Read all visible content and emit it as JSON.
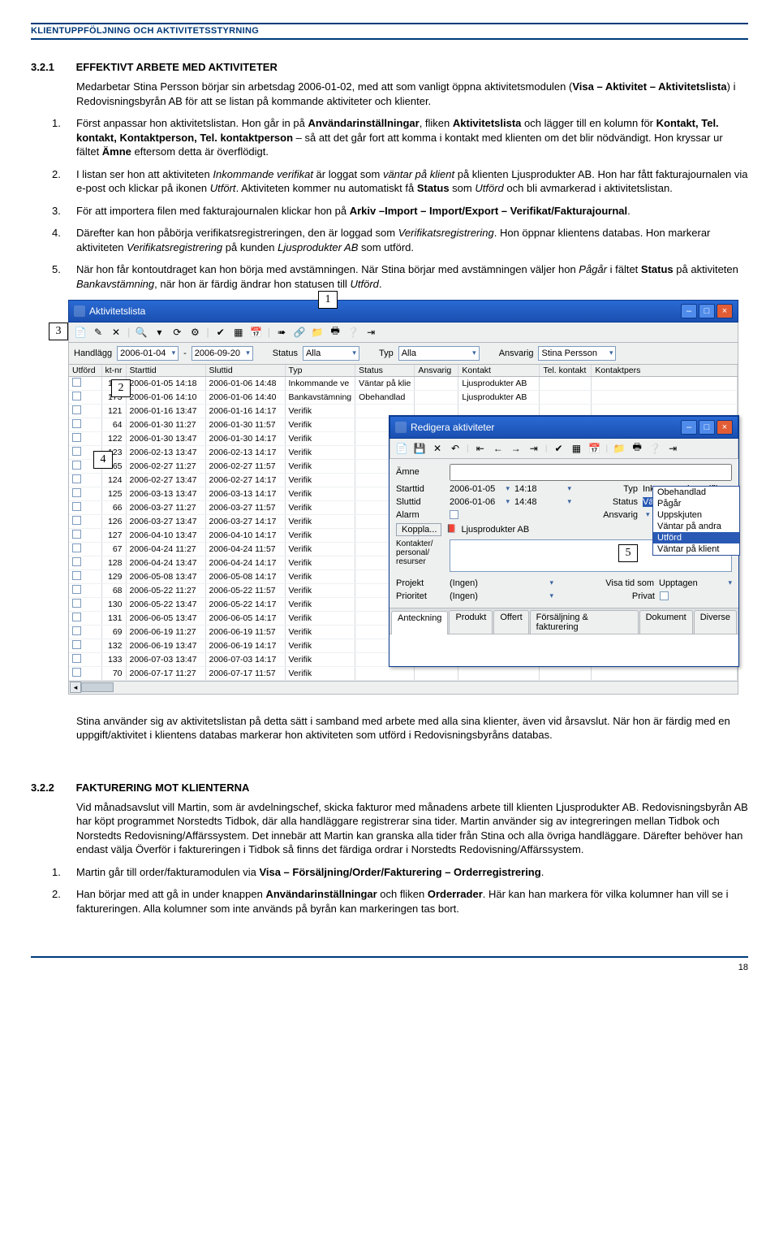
{
  "page": {
    "header": "KLIENTUPPFÖLJNING OCH AKTIVITETSSTYRNING",
    "pagenum": "18"
  },
  "sec1": {
    "num": "3.2.1",
    "title": "EFFEKTIVT ARBETE MED AKTIVITETER",
    "intro_a": "Medarbetar Stina Persson börjar sin arbetsdag 2006-01-02, med att som vanligt öppna aktivitetsmodulen (",
    "intro_b": "Visa – Aktivitet – Aktivitetslista",
    "intro_c": ") i Redovisningsbyrån AB för att se listan på kommande aktiviteter och klienter.",
    "li1_a": "Först anpassar hon aktivitetslistan. Hon går in på ",
    "li1_b": "Användarinställningar",
    "li1_c": ", fliken ",
    "li1_d": "Aktivitetslista",
    "li1_e": " och lägger till en kolumn för ",
    "li1_f": "Kontakt, Tel. kontakt, Kontaktperson, Tel. kontaktperson",
    "li1_g": " – så att det går fort att komma i kontakt med klienten om det blir nödvändigt. Hon kryssar ur fältet ",
    "li1_h": "Ämne",
    "li1_i": " eftersom detta är överflödigt.",
    "li2_a": "I listan ser hon att aktiviteten ",
    "li2_b": "Inkommande verifikat",
    "li2_c": " är loggat som ",
    "li2_d": "väntar på klient",
    "li2_e": " på klienten Ljusprodukter AB. Hon har fått fakturajournalen via e-post och klickar på ikonen ",
    "li2_f": "Utfört",
    "li2_g": ". Aktiviteten kommer nu automatiskt få ",
    "li2_h": "Status",
    "li2_i": " som ",
    "li2_j": "Utförd",
    "li2_k": " och bli avmarkerad i aktivitetslistan.",
    "li3_a": "För att importera filen med fakturajournalen klickar hon på ",
    "li3_b": "Arkiv –Import – Import/Export – Verifikat/Fakturajournal",
    "li3_c": ".",
    "li4_a": "Därefter kan hon påbörja verifikatsregistreringen, den är loggad som ",
    "li4_b": "Verifikatsregistrering",
    "li4_c": ". Hon öppnar klientens databas. Hon markerar aktiviteten ",
    "li4_d": "Verifikatsregistrering",
    "li4_e": " på kunden ",
    "li4_f": "Ljusprodukter AB",
    "li4_g": " som utförd.",
    "li5_a": "När hon får kontoutdraget kan hon börja med avstämningen. När Stina börjar med avstämningen väljer hon ",
    "li5_b": "Pågår",
    "li5_c": " i fältet ",
    "li5_d": "Status",
    "li5_e": " på aktiviteten ",
    "li5_f": "Bankavstämning",
    "li5_g": ", när hon är färdig ändrar hon statusen till ",
    "li5_h": "Utförd",
    "li5_i": ".",
    "footer_para": "Stina använder sig av aktivitetslistan på detta sätt i samband med arbete med alla sina klienter, även vid årsavslut. När hon är färdig med en uppgift/aktivitet i klientens databas markerar hon aktiviteten som utförd i Redovisningsbyråns databas."
  },
  "shot1": {
    "title": "Aktivitetslista",
    "filters": {
      "handlagg_label": "Handlägg",
      "date1": "2006-01-04",
      "date2": "2006-09-20",
      "status_lbl": "Status",
      "status_val": "Alla",
      "typ_lbl": "Typ",
      "typ_val": "Alla",
      "ansvarig_lbl": "Ansvarig",
      "ansvarig_val": "Stina Persson"
    },
    "cols": {
      "utford": "Utförd",
      "ktnr": "kt-nr",
      "starttid": "Starttid",
      "sluttid": "Sluttid",
      "typ": "Typ",
      "status": "Status",
      "ansvarig": "Ansvarig",
      "kontakt": "Kontakt",
      "telk": "Tel. kontakt",
      "kontaktp": "Kontaktpers"
    },
    "rows": [
      {
        "n": "175",
        "s": "2006-01-05 14:18",
        "e": "2006-01-06 14:48",
        "t": "Inkommande ve",
        "st": "Väntar på klie",
        "k": "Ljusprodukter AB"
      },
      {
        "n": "173",
        "s": "2006-01-06 14:10",
        "e": "2006-01-06 14:40",
        "t": "Bankavstämning",
        "st": "Obehandlad",
        "k": "Ljusprodukter AB"
      },
      {
        "n": "121",
        "s": "2006-01-16 13:47",
        "e": "2006-01-16 14:17",
        "t": "Verifik",
        "st": "",
        "k": ""
      },
      {
        "n": "64",
        "s": "2006-01-30 11:27",
        "e": "2006-01-30 11:57",
        "t": "Verifik",
        "st": "",
        "k": ""
      },
      {
        "n": "122",
        "s": "2006-01-30 13:47",
        "e": "2006-01-30 14:17",
        "t": "Verifik",
        "st": "",
        "k": ""
      },
      {
        "n": "123",
        "s": "2006-02-13 13:47",
        "e": "2006-02-13 14:17",
        "t": "Verifik",
        "st": "",
        "k": ""
      },
      {
        "n": "65",
        "s": "2006-02-27 11:27",
        "e": "2006-02-27 11:57",
        "t": "Verifik",
        "st": "",
        "k": ""
      },
      {
        "n": "124",
        "s": "2006-02-27 13:47",
        "e": "2006-02-27 14:17",
        "t": "Verifik",
        "st": "",
        "k": ""
      },
      {
        "n": "125",
        "s": "2006-03-13 13:47",
        "e": "2006-03-13 14:17",
        "t": "Verifik",
        "st": "",
        "k": ""
      },
      {
        "n": "66",
        "s": "2006-03-27 11:27",
        "e": "2006-03-27 11:57",
        "t": "Verifik",
        "st": "",
        "k": ""
      },
      {
        "n": "126",
        "s": "2006-03-27 13:47",
        "e": "2006-03-27 14:17",
        "t": "Verifik",
        "st": "",
        "k": ""
      },
      {
        "n": "127",
        "s": "2006-04-10 13:47",
        "e": "2006-04-10 14:17",
        "t": "Verifik",
        "st": "",
        "k": ""
      },
      {
        "n": "67",
        "s": "2006-04-24 11:27",
        "e": "2006-04-24 11:57",
        "t": "Verifik",
        "st": "",
        "k": ""
      },
      {
        "n": "128",
        "s": "2006-04-24 13:47",
        "e": "2006-04-24 14:17",
        "t": "Verifik",
        "st": "",
        "k": ""
      },
      {
        "n": "129",
        "s": "2006-05-08 13:47",
        "e": "2006-05-08 14:17",
        "t": "Verifik",
        "st": "",
        "k": ""
      },
      {
        "n": "68",
        "s": "2006-05-22 11:27",
        "e": "2006-05-22 11:57",
        "t": "Verifik",
        "st": "",
        "k": ""
      },
      {
        "n": "130",
        "s": "2006-05-22 13:47",
        "e": "2006-05-22 14:17",
        "t": "Verifik",
        "st": "",
        "k": ""
      },
      {
        "n": "131",
        "s": "2006-06-05 13:47",
        "e": "2006-06-05 14:17",
        "t": "Verifik",
        "st": "",
        "k": ""
      },
      {
        "n": "69",
        "s": "2006-06-19 11:27",
        "e": "2006-06-19 11:57",
        "t": "Verifik",
        "st": "",
        "k": ""
      },
      {
        "n": "132",
        "s": "2006-06-19 13:47",
        "e": "2006-06-19 14:17",
        "t": "Verifik",
        "st": "",
        "k": ""
      },
      {
        "n": "133",
        "s": "2006-07-03 13:47",
        "e": "2006-07-03 14:17",
        "t": "Verifik",
        "st": "",
        "k": ""
      },
      {
        "n": "70",
        "s": "2006-07-17 11:27",
        "e": "2006-07-17 11:57",
        "t": "Verifik",
        "st": "",
        "k": ""
      }
    ]
  },
  "popup": {
    "title": "Redigera aktiviteter",
    "amne": "Ämne",
    "starttid": "Starttid",
    "start_d": "2006-01-05",
    "start_t": "14:18",
    "typ_lbl": "Typ",
    "typ_val": "Inkommande verifik",
    "sluttid": "Sluttid",
    "slut_d": "2006-01-06",
    "slut_t": "14:48",
    "status_lbl": "Status",
    "status_val": "Väntar på klient",
    "alarm": "Alarm",
    "ansvarig": "Ansvarig",
    "koppla": "Koppla...",
    "kpers": "Kontakter/\npersonal/\nresurser",
    "kompany": "Ljusprodukter AB",
    "projekt": "Projekt",
    "proj_val": "(Ingen)",
    "visa_tid": "Visa tid som",
    "visa_val": "Upptagen",
    "prioritet": "Prioritet",
    "prio_val": "(Ingen)",
    "privat": "Privat",
    "statuslist": [
      "Obehandlad",
      "Pågår",
      "Uppskjuten",
      "Väntar på andra",
      "Utförd",
      "Väntar på klient"
    ],
    "tabs": [
      "Anteckning",
      "Produkt",
      "Offert",
      "Försäljning & fakturering",
      "Dokument",
      "Diverse"
    ]
  },
  "callouts": {
    "c1": "1",
    "c2": "2",
    "c3": "3",
    "c4": "4",
    "c5": "5"
  },
  "sec2": {
    "num": "3.2.2",
    "title": "FAKTURERING MOT KLIENTERNA",
    "intro": "Vid månadsavslut vill Martin, som är avdelningschef, skicka fakturor med månadens arbete till klienten Ljusprodukter AB. Redovisningsbyrån AB har köpt programmet Norstedts Tidbok, där alla handläggare registrerar sina tider. Martin använder sig av integreringen mellan Tidbok och Norstedts Redovisning/Affärssystem. Det innebär att Martin kan granska alla tider från Stina och alla övriga handläggare. Därefter behöver han endast välja Överför i faktureringen i Tidbok så finns det färdiga ordrar i Norstedts Redovisning/Affärssystem.",
    "li1_a": "Martin går till order/fakturamodulen via ",
    "li1_b": "Visa – Försäljning/Order/Fakturering – Orderregistrering",
    "li1_c": ".",
    "li2_a": "Han börjar med att gå in under knappen ",
    "li2_b": "Användarinställningar",
    "li2_c": " och fliken ",
    "li2_d": "Orderrader",
    "li2_e": ". Här kan han markera för vilka kolumner han vill se i faktureringen. Alla kolumner som inte används på byrån kan markeringen tas bort."
  }
}
